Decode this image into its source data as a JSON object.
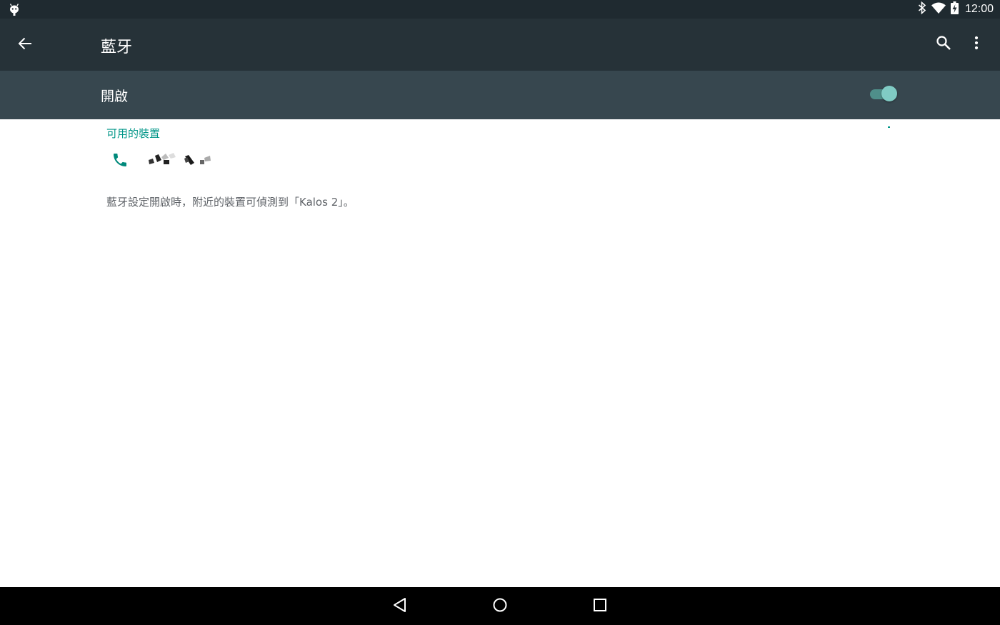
{
  "status_bar": {
    "time": "12:00",
    "icons": [
      "android-debug-icon",
      "bluetooth-icon",
      "wifi-icon",
      "battery-charging-icon"
    ]
  },
  "toolbar": {
    "title": "藍牙",
    "icons": [
      "arrow-back-icon",
      "search-icon",
      "more-vert-icon"
    ]
  },
  "master_switch": {
    "label": "開啟",
    "checked": true,
    "accent_color": "#80cbc4"
  },
  "available_devices": {
    "header": "可用的裝置",
    "devices": [
      {
        "icon": "phone-icon",
        "name_obscured": true
      }
    ]
  },
  "footer": {
    "text": "藍牙設定開啟時，附近的裝置可偵測到「Kalos 2」。"
  },
  "navigation_bar": {
    "icons": [
      "nav-back-icon",
      "nav-home-icon",
      "nav-recents-icon"
    ]
  },
  "colors": {
    "status_bar": "#1f2a30",
    "toolbar": "#263238",
    "switch_bar": "#37474f",
    "accent": "#009688",
    "body_text": "#5f6368"
  }
}
